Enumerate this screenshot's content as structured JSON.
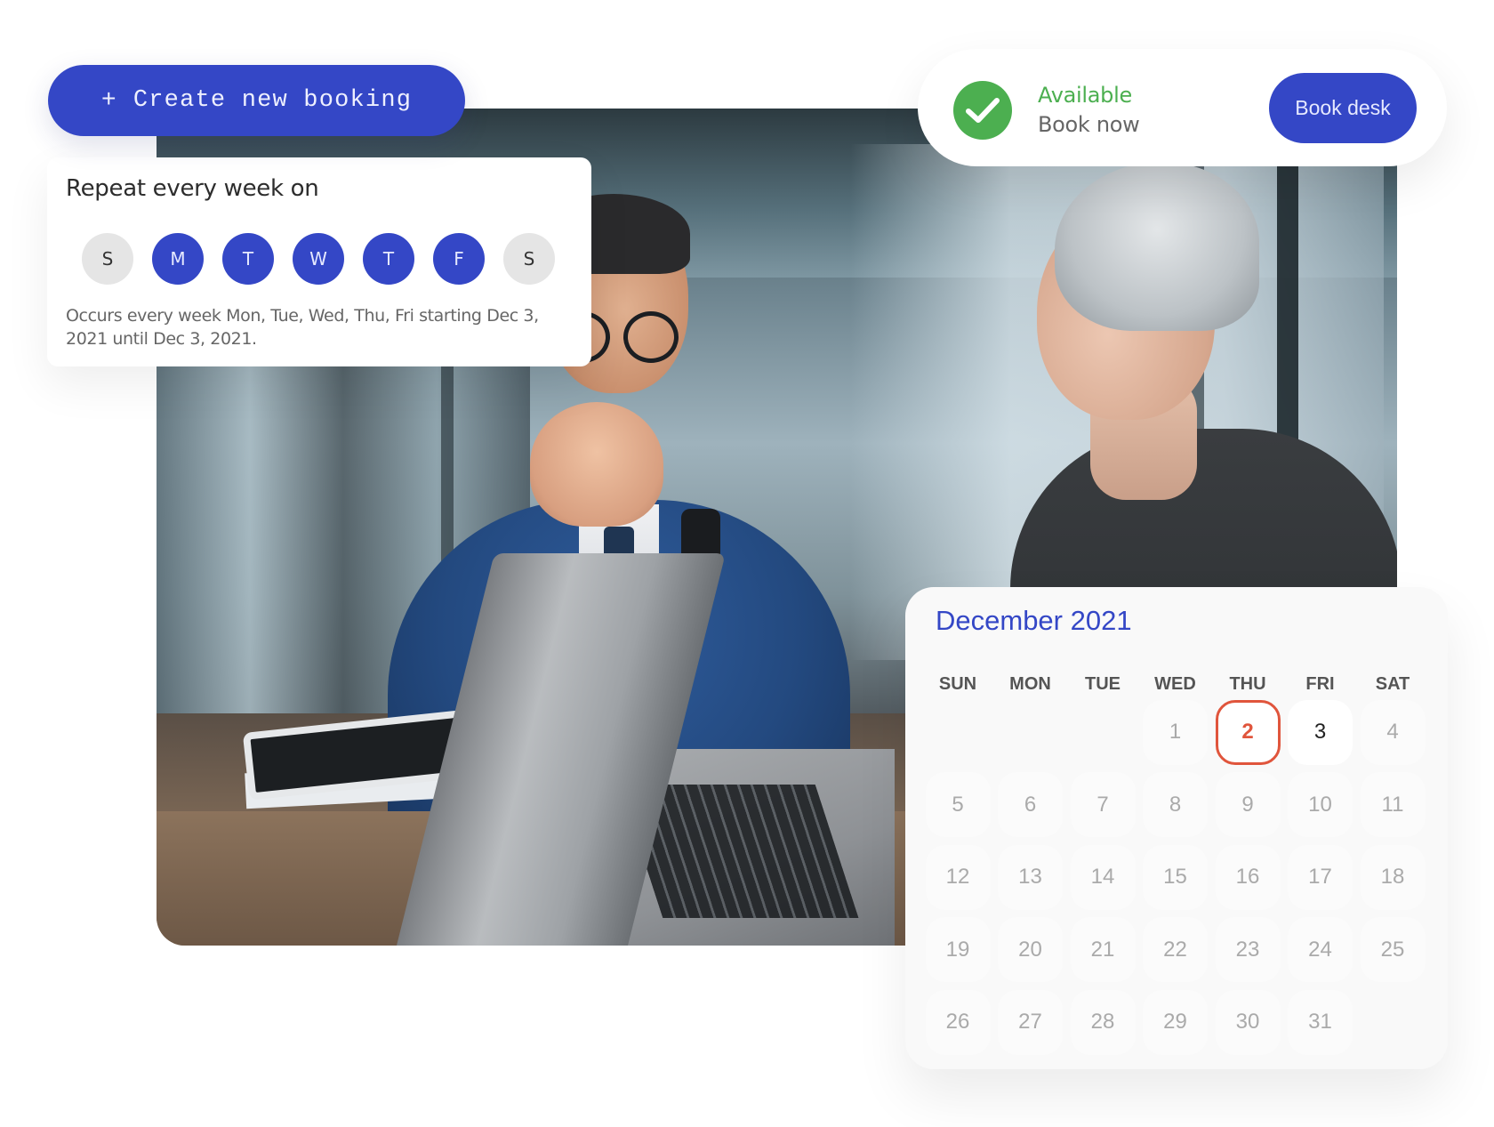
{
  "colors": {
    "primary": "#3447c6",
    "available": "#4caf50",
    "today_outline": "#e0553c"
  },
  "create_booking": {
    "icon": "plus-icon",
    "label": "Create new booking"
  },
  "repeat": {
    "title": "Repeat every week on",
    "days": [
      {
        "label": "S",
        "selected": false
      },
      {
        "label": "M",
        "selected": true
      },
      {
        "label": "T",
        "selected": true
      },
      {
        "label": "W",
        "selected": true
      },
      {
        "label": "T",
        "selected": true
      },
      {
        "label": "F",
        "selected": true
      },
      {
        "label": "S",
        "selected": false
      }
    ],
    "description": "Occurs every week Mon, Tue, Wed, Thu, Fri starting Dec 3, 2021 until Dec 3, 2021."
  },
  "availability": {
    "icon": "check-circle-icon",
    "status": "Available",
    "subtitle": "Book now",
    "button_label": "Book desk"
  },
  "calendar": {
    "title": "December 2021",
    "weekdays": [
      "SUN",
      "MON",
      "TUE",
      "WED",
      "THU",
      "FRI",
      "SAT"
    ],
    "first_weekday_index": 3,
    "days_in_month": 31,
    "today": 2,
    "selected": 3
  },
  "photo": {
    "description": "Two colleagues talking at a desk with a laptop in an office"
  }
}
